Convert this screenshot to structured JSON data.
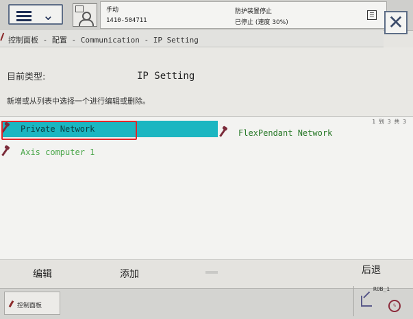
{
  "topbar": {
    "mode": "手动",
    "controller": "1410-504711",
    "status_line1": "防护装置停止",
    "status_line2": "已停止 (速度 30%)"
  },
  "breadcrumb": {
    "text": "控制面板 - 配置 - Communication - IP Setting"
  },
  "header": {
    "type_label": "目前类型:",
    "type_value": "IP Setting",
    "instruction": "新增或从列表中选择一个进行编辑或删除。"
  },
  "list": {
    "page_indicator": "1 到 3 共 3",
    "items": [
      {
        "label": "Private Network",
        "selected": true
      },
      {
        "label": "FlexPendant Network",
        "selected": false
      },
      {
        "label": "Axis computer 1",
        "selected": false
      }
    ]
  },
  "commands": {
    "edit": "编辑",
    "add": "添加",
    "back": "后退"
  },
  "taskbar": {
    "tab_label": "控制面板",
    "rob_label": "ROB_1"
  },
  "colors": {
    "selection": "#1bb6c1",
    "highlight_box": "#e0262a",
    "item_text_green": "#2a7a2a"
  }
}
